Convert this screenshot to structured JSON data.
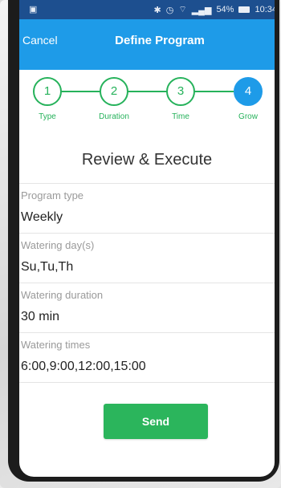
{
  "status_bar": {
    "signal": "54%",
    "time": "10:34"
  },
  "nav": {
    "cancel_label": "Cancel",
    "title": "Define Program"
  },
  "steps": [
    {
      "number": "1",
      "label": "Type"
    },
    {
      "number": "2",
      "label": "Duration"
    },
    {
      "number": "3",
      "label": "Time"
    },
    {
      "number": "4",
      "label": "Grow"
    }
  ],
  "review": {
    "title": "Review & Execute",
    "fields": [
      {
        "label": "Program type",
        "value": "Weekly"
      },
      {
        "label": "Watering day(s)",
        "value": "Su,Tu,Th"
      },
      {
        "label": "Watering duration",
        "value": "30 min"
      },
      {
        "label": "Watering times",
        "value": "6:00,9:00,12:00,15:00"
      }
    ]
  },
  "send_label": "Send",
  "colors": {
    "nav_blue": "#1e9be8",
    "step_green": "#26b25b",
    "send_green": "#2bb55c",
    "status_bar": "#1d4f8f"
  }
}
